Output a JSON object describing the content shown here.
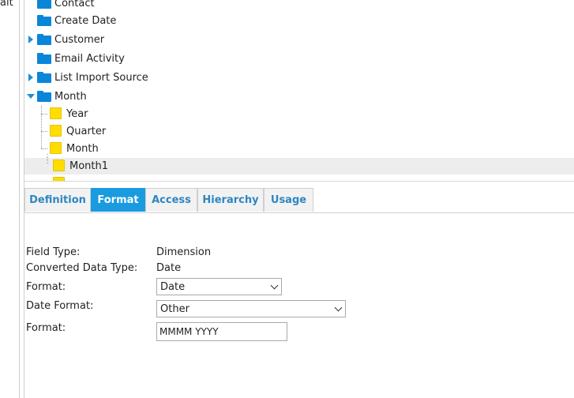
{
  "left_panel": {
    "clipped_text": "ait"
  },
  "tree": {
    "items": [
      {
        "label": "Contact"
      },
      {
        "label": "Create Date"
      },
      {
        "label": "Customer"
      },
      {
        "label": "Email Activity"
      },
      {
        "label": "List Import Source"
      },
      {
        "label": "Month"
      },
      {
        "label": "Year"
      },
      {
        "label": "Quarter"
      },
      {
        "label": "Month"
      },
      {
        "label": "Month1"
      }
    ]
  },
  "tabs": [
    {
      "label": "Definition"
    },
    {
      "label": "Format"
    },
    {
      "label": "Access"
    },
    {
      "label": "Hierarchy"
    },
    {
      "label": "Usage"
    }
  ],
  "form": {
    "field_type_label": "Field Type:",
    "field_type_value": "Dimension",
    "converted_label": "Converted Data Type:",
    "converted_value": "Date",
    "format_label": "Format:",
    "format_value": "Date",
    "date_format_label": "Date Format:",
    "date_format_value": "Other",
    "format2_label": "Format:",
    "format2_value": "MMMM YYYY"
  },
  "colors": {
    "accent": "#1a9be0",
    "folder": "#0a86d8",
    "leaf": "#ffdd00"
  }
}
